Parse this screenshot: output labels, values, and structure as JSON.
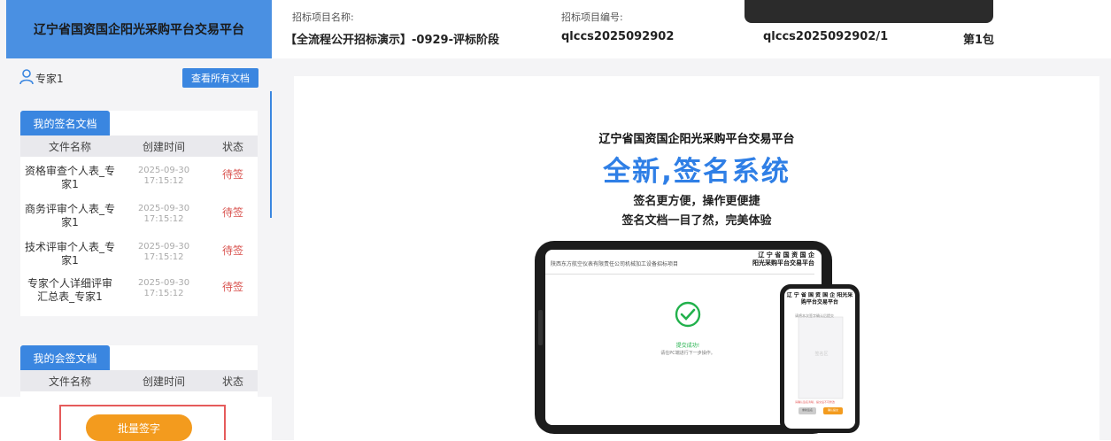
{
  "sidebar": {
    "brand": "辽宁省国资国企阳光采购平台交易平台",
    "user": "专家1",
    "view_all_docs": "查看所有文档",
    "sign_docs": {
      "tab": "我的签名文档",
      "headers": [
        "文件名称",
        "创建时间",
        "状态"
      ],
      "rows": [
        {
          "name": "资格审查个人表_专家1",
          "time": "2025-09-30 17:15:12",
          "status": "待签"
        },
        {
          "name": "商务评审个人表_专家1",
          "time": "2025-09-30 17:15:12",
          "status": "待签"
        },
        {
          "name": "技术评审个人表_专家1",
          "time": "2025-09-30 17:15:12",
          "status": "待签"
        },
        {
          "name": "专家个人详细评审汇总表_专家1",
          "time": "2025-09-30 17:15:12",
          "status": "待签"
        }
      ]
    },
    "cosign_docs": {
      "tab": "我的会签文档",
      "headers": [
        "文件名称",
        "创建时间",
        "状态"
      ]
    },
    "batch_sign": "批量签字"
  },
  "header": {
    "project_name_label": "招标项目名称:",
    "project_name": "【全流程公开招标演示】-0929-评标阶段",
    "project_no_label": "招标项目编号:",
    "project_no": "qlccs2025092902",
    "package_no": "qlccs2025092902/1",
    "package": "第1包"
  },
  "promo": {
    "org": "辽宁省国资国企阳光采购平台交易平台",
    "headline": "全新,签名系统",
    "line1": "签名更方便，操作更便捷",
    "line2": "签名文档一目了然，完美体验",
    "tablet_project": "陕西东方航空仪表有限责任公司机械加工设备招标项目",
    "tablet_logo": "辽 宁 省 国 资 国 企\n阳光采购平台交易平台",
    "tablet_success": "提交成功!",
    "tablet_hint": "请在PC端进行下一步操作。",
    "phone_logo": "辽 宁 省 国 资 国 企 阳光采购平台交易平台",
    "phone_prompt": "请将本次签字确认后提交",
    "phone_watermark": "签名区",
    "phone_warning": "请确认签名清晰，提交后不可修改",
    "phone_btn_cancel": "重新签名",
    "phone_btn_ok": "确认提交"
  },
  "colors": {
    "accent": "#3a86e0",
    "brand_bg": "#4a90e2",
    "pending": "#d9534f",
    "batch": "#f39b1e",
    "success": "#22b14c"
  }
}
